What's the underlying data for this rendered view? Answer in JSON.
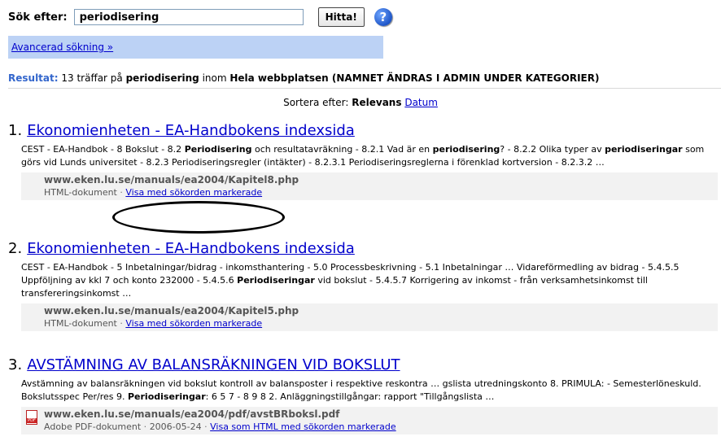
{
  "search": {
    "label": "Sök efter:",
    "value": "periodisering",
    "button_label": "Hitta!",
    "help_icon": "?"
  },
  "advanced_link": "Avancerad sökning »",
  "summary": {
    "label": "Resultat:",
    "text_pre": " 13 träffar på ",
    "term": "periodisering",
    "text_mid": " inom ",
    "scope": "Hela webbplatsen (NAMNET ÄNDRAS I ADMIN UNDER KATEGORIER)"
  },
  "sort": {
    "label": "Sortera efter:",
    "active": "Relevans",
    "alt_link": "Datum"
  },
  "results": [
    {
      "number": "1.",
      "title": "Ekonomienheten - EA-Handbokens indexsida",
      "snippet_parts": [
        {
          "t": "CEST - EA-Handbok - 8 Bokslut - 8.2 ",
          "b": false
        },
        {
          "t": "Periodisering",
          "b": true
        },
        {
          "t": " och resultatavräkning - 8.2.1 Vad är en ",
          "b": false
        },
        {
          "t": "periodisering",
          "b": true
        },
        {
          "t": "? - 8.2.2 Olika typer av ",
          "b": false
        },
        {
          "t": "periodiseringar",
          "b": true
        },
        {
          "t": " som görs vid Lunds universitet - 8.2.3 Periodiseringsregler (intäkter) - 8.2.3.1 Periodiseringsreglerna i förenklad kortversion - 8.2.3.2 …",
          "b": false
        }
      ],
      "url": "www.eken.lu.se/manuals/ea2004/Kapitel8.php",
      "doc_type": "HTML-dokument",
      "sep": " · ",
      "link": "Visa med sökorden markerade"
    },
    {
      "number": "2.",
      "title": "Ekonomienheten - EA-Handbokens indexsida",
      "snippet_parts": [
        {
          "t": "CEST - EA-Handbok - 5 Inbetalningar/bidrag - inkomsthantering - 5.0 Processbeskrivning - 5.1 Inbetalningar … Vidareförmedling av bidrag - 5.4.5.5 Uppföljning av kkl 7 och konto 232000 - 5.4.5.6 ",
          "b": false
        },
        {
          "t": "Periodiseringar",
          "b": true
        },
        {
          "t": " vid bokslut - 5.4.5.7 Korrigering av inkomst - från verksamhetsinkomst till transfereringsinkomst …",
          "b": false
        }
      ],
      "url": "www.eken.lu.se/manuals/ea2004/Kapitel5.php",
      "doc_type": "HTML-dokument",
      "sep": " · ",
      "link": "Visa med sökorden markerade"
    },
    {
      "number": "3.",
      "title": "AVSTÄMNING AV BALANSRÄKNINGEN VID BOKSLUT",
      "snippet_parts": [
        {
          "t": "Avstämning av balansräkningen vid bokslut  kontroll av balansposter i respektive reskontra … gslista utredningskonto 8. PRIMULA: - Semesterlöneskuld. Bokslutsspec Per/res 9. ",
          "b": false
        },
        {
          "t": "Periodiseringar",
          "b": true
        },
        {
          "t": ": 6 5 7 - 8 9 8 2. Anläggningstillgångar: rapport \"Tillgångslista  …",
          "b": false
        }
      ],
      "url": "www.eken.lu.se/manuals/ea2004/pdf/avstBRboksl.pdf",
      "doc_type": "Adobe PDF-dokument",
      "date": "2006-05-24",
      "sep": " · ",
      "link": "Visa som HTML med sökorden markerade",
      "icon": "pdf-icon"
    }
  ]
}
